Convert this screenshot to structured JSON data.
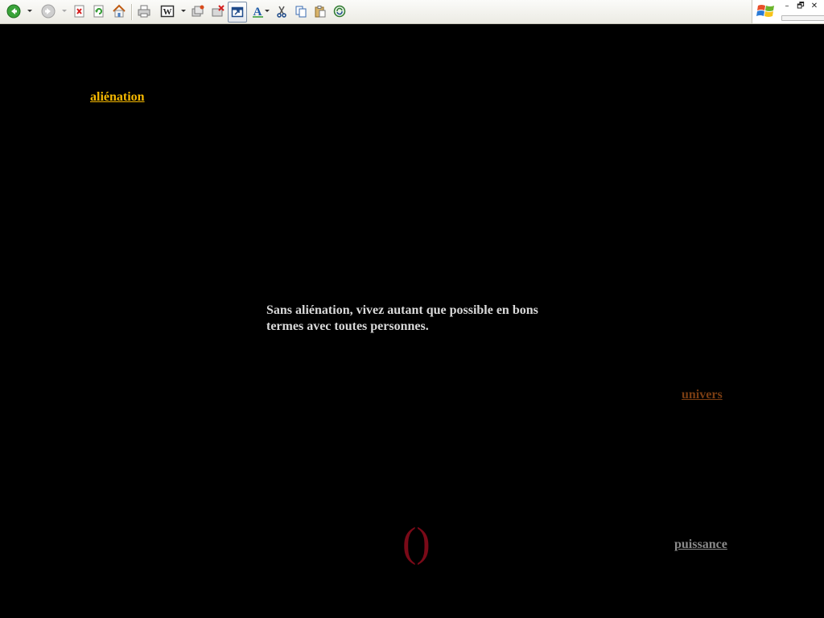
{
  "toolbar": {
    "buttons": [
      {
        "name": "back-button",
        "icon": "back-arrow-icon"
      },
      {
        "name": "forward-button",
        "icon": "forward-arrow-icon"
      },
      {
        "name": "stop-button",
        "icon": "stop-icon"
      },
      {
        "name": "refresh-button",
        "icon": "refresh-icon"
      },
      {
        "name": "home-button",
        "icon": "home-icon"
      },
      {
        "name": "print-button",
        "icon": "printer-icon"
      },
      {
        "name": "edit-button",
        "icon": "word-editor-icon"
      },
      {
        "name": "discuss-button",
        "icon": "discuss-icon"
      },
      {
        "name": "research-button",
        "icon": "research-icon"
      },
      {
        "name": "fullscreen-button",
        "icon": "fullscreen-icon"
      },
      {
        "name": "font-size-button",
        "icon": "font-size-icon"
      },
      {
        "name": "cut-button",
        "icon": "scissors-icon"
      },
      {
        "name": "copy-button",
        "icon": "copy-icon"
      },
      {
        "name": "paste-button",
        "icon": "paste-icon"
      },
      {
        "name": "sync-button",
        "icon": "sync-icon"
      }
    ]
  },
  "window": {
    "minimize_label": "–",
    "restore_label": "🗗",
    "close_label": "✕"
  },
  "page": {
    "link_alienation": "aliénation",
    "quote": "Sans aliénation, vivez autant que possible en bons termes avec toutes personnes.",
    "link_univers": "univers",
    "link_puissance": "puissance",
    "parens": "()"
  },
  "colors": {
    "background": "#000000",
    "alienation_link": "#f5b800",
    "univers_link": "#7a3d12",
    "puissance_link": "#8a8a8a",
    "quote_text": "#d9d9d9",
    "parens": "#7a0a18"
  }
}
